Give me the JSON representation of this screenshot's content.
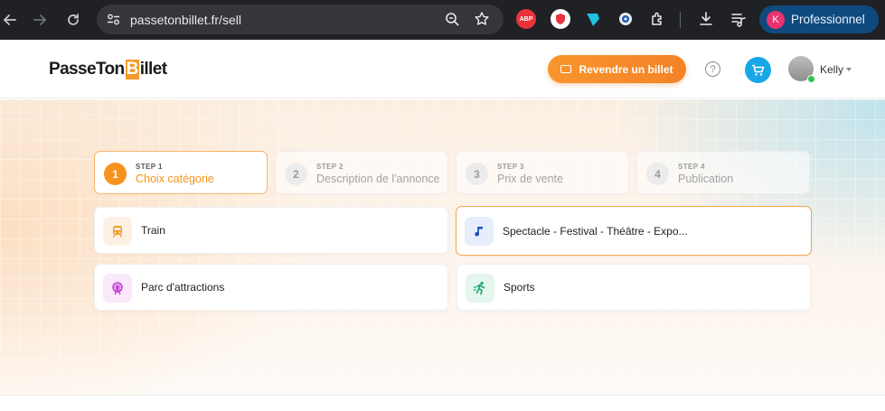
{
  "browser": {
    "url": "passetonbillet.fr/sell",
    "profile_initial": "K",
    "profile_label": "Professionnel",
    "ext_abp": "ABP"
  },
  "header": {
    "logo_part1": "PasseTon",
    "logo_b": "B",
    "logo_part2": "illet",
    "sell_button": "Revendre un billet",
    "help_glyph": "?",
    "user_name": "Kelly"
  },
  "steps": [
    {
      "number": "1",
      "kicker": "STEP 1",
      "title": "Choix catégorie",
      "active": true
    },
    {
      "number": "2",
      "kicker": "STEP 2",
      "title": "Description de l'annonce",
      "active": false
    },
    {
      "number": "3",
      "kicker": "STEP 3",
      "title": "Prix de vente",
      "active": false
    },
    {
      "number": "4",
      "kicker": "STEP 4",
      "title": "Publication",
      "active": false
    }
  ],
  "categories": [
    {
      "label": "Train",
      "icon": "train-icon",
      "color": "#f39a2b",
      "bg": "#fdf1e6"
    },
    {
      "label": "Spectacle - Festival - Théâtre - Expo...",
      "icon": "music-note-icon",
      "color": "#1f4fb8",
      "bg": "#e6eefb",
      "selected": true
    },
    {
      "label": "Parc d'attractions",
      "icon": "ferris-wheel-icon",
      "color": "#c43ed6",
      "bg": "#fae8fb"
    },
    {
      "label": "Sports",
      "icon": "running-person-icon",
      "color": "#14a36a",
      "bg": "#e4f6ee"
    }
  ],
  "colors": {
    "accent": "#f7921e",
    "cart": "#18a8e8",
    "chrome_bg": "#202124",
    "profile_pill": "#0e4a7d"
  }
}
